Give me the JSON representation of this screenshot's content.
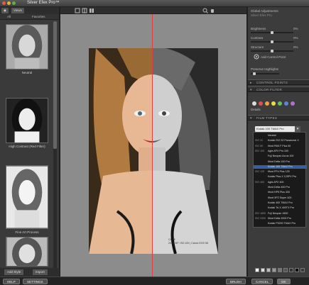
{
  "app": {
    "title": "Silver Efex Pro™"
  },
  "left_panel": {
    "toolbar": {
      "views_label": "Views"
    },
    "tabs": [
      "All",
      "Favorites"
    ],
    "presets": [
      {
        "label": "Neutral"
      },
      {
        "label": "High Contrast (Red Filter)"
      },
      {
        "label": "Fine Art Process"
      }
    ],
    "bottom": {
      "add_label": "Add Style",
      "import_label": "Import"
    }
  },
  "image": {
    "caption_line1": "CA.tiff",
    "caption_line2": "24 | EXIF: ISO 100 | Canon EOS 5D"
  },
  "right_panel": {
    "global_adjustments": "Global Adjustments",
    "preset_name": "Silver Efex Pro",
    "sliders": [
      {
        "label": "Brightness",
        "value": "0%"
      },
      {
        "label": "Contrast",
        "value": "0%"
      },
      {
        "label": "Structure",
        "value": "0%"
      }
    ],
    "add_control_point": "Add Control Point",
    "protect_highlights": "Preserve Highlights",
    "sections": {
      "control_points": "CONTROL POINTS",
      "color_filter": "COLOR FILTER",
      "film_types": "FILM TYPES"
    },
    "color_filter_strength": "Details",
    "film_select": "Kodak 100 TMAX Pro",
    "color_filter_dots": [
      {
        "name": "neutral",
        "color": "#dddddd"
      },
      {
        "name": "red",
        "color": "#e05050"
      },
      {
        "name": "orange",
        "color": "#f0a040"
      },
      {
        "name": "yellow",
        "color": "#e8e040"
      },
      {
        "name": "green",
        "color": "#60c060"
      },
      {
        "name": "blue",
        "color": "#6080e0"
      },
      {
        "name": "violet",
        "color": "#b070d0"
      }
    ],
    "film_list": [
      {
        "iso": "",
        "name": "Neutral",
        "selected": false
      },
      {
        "iso": "ISO 32",
        "name": "Kodak ISO 32 Panatomic X",
        "selected": false
      },
      {
        "iso": "ISO 50",
        "name": "Ilford PAN F Plus 50",
        "selected": false
      },
      {
        "iso": "ISO 100",
        "name": "Agfa APX Pro 100",
        "selected": false
      },
      {
        "iso": "",
        "name": "Fuji Neopan Acros 100",
        "selected": false
      },
      {
        "iso": "",
        "name": "Ilford Delta 100 Pro",
        "selected": false
      },
      {
        "iso": "",
        "name": "Kodak 100 TMAX Pro",
        "selected": true
      },
      {
        "iso": "ISO 125",
        "name": "Ilford FP4 Plus 125",
        "selected": false
      },
      {
        "iso": "",
        "name": "Kodak Plus-X 125PX Pro",
        "selected": false
      },
      {
        "iso": "ISO 400",
        "name": "Agfa APX 400",
        "selected": false
      },
      {
        "iso": "",
        "name": "Ilford Delta 400 Pro",
        "selected": false
      },
      {
        "iso": "",
        "name": "Ilford HP5 Plus 400",
        "selected": false
      },
      {
        "iso": "",
        "name": "Ilford XP2 Super 400",
        "selected": false
      },
      {
        "iso": "",
        "name": "Kodak 400 TMAX Pro",
        "selected": false
      },
      {
        "iso": "",
        "name": "Kodak Tri-X 400TX Pro",
        "selected": false
      },
      {
        "iso": "ISO 1600",
        "name": "Fuji Neopan 1600",
        "selected": false
      },
      {
        "iso": "ISO 3200",
        "name": "Ilford Delta 3200 Pro",
        "selected": false
      },
      {
        "iso": "",
        "name": "Kodak P3200 TMAX Pro",
        "selected": false
      }
    ]
  },
  "bottom_bar": {
    "help": "HELP",
    "settings": "SETTINGS",
    "brush": "BRUSH",
    "cancel": "CANCEL",
    "ok": "OK"
  }
}
